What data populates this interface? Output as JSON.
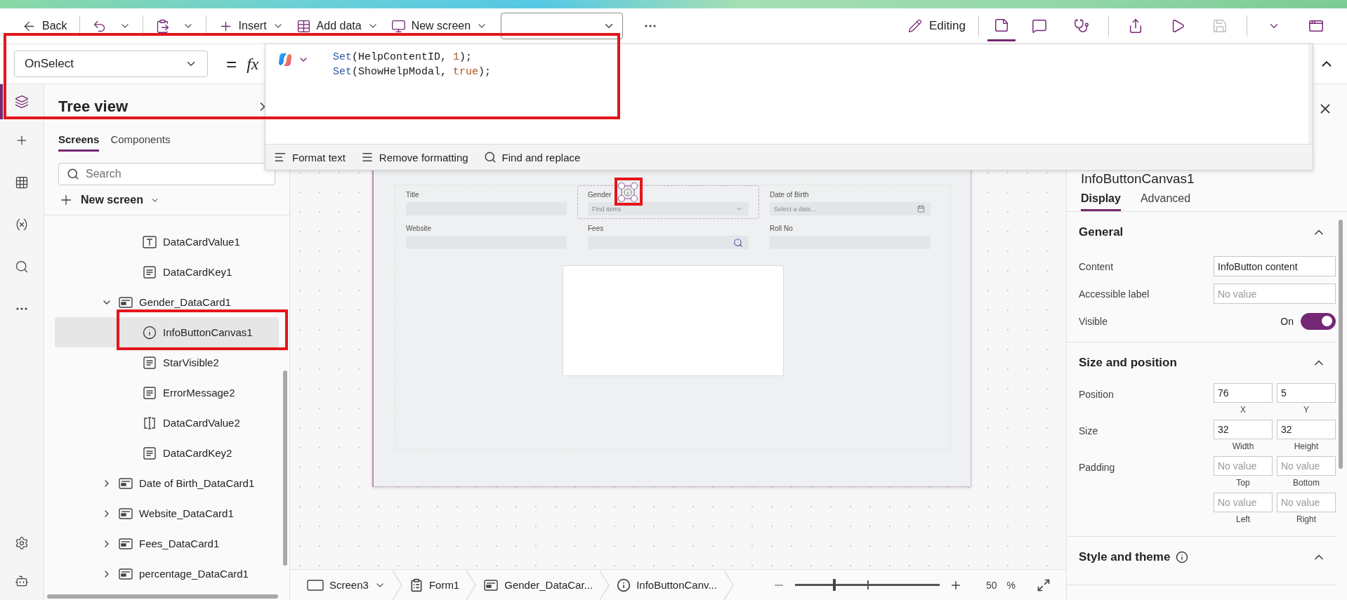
{
  "toolbar": {
    "left_groups": [
      [
        {
          "kind": "back",
          "label": "Back",
          "has_menu": false
        }
      ],
      [
        {
          "kind": "undo",
          "has_menu": true
        }
      ],
      [
        {
          "kind": "paste",
          "has_menu": true
        }
      ],
      [
        {
          "kind": "insert",
          "label": "Insert",
          "has_menu": true
        },
        {
          "kind": "add_data",
          "label": "Add data",
          "has_menu": true
        },
        {
          "kind": "new_screen",
          "label": "New screen",
          "has_menu": true
        }
      ]
    ],
    "mode": "Editing",
    "tool_groups": [
      [
        {
          "kind": "notes",
          "selected": true,
          "disabled": false
        },
        {
          "kind": "comments",
          "selected": false,
          "disabled": false
        },
        {
          "kind": "checker",
          "selected": false,
          "disabled": false
        }
      ],
      [
        {
          "kind": "share",
          "selected": false,
          "disabled": false
        },
        {
          "kind": "play",
          "selected": false,
          "disabled": false
        },
        {
          "kind": "save",
          "selected": false,
          "disabled": true
        }
      ],
      [
        {
          "kind": "caret",
          "selected": false,
          "disabled": false
        },
        {
          "kind": "publish",
          "selected": false,
          "disabled": false
        }
      ]
    ]
  },
  "formula": {
    "property": "OnSelect",
    "equals": "=",
    "fx": "fx",
    "lines": [
      [
        {
          "t": "Set",
          "kind": "function"
        },
        {
          "t": "(",
          "kind": "punct"
        },
        {
          "t": "HelpContentID",
          "kind": "identifier"
        },
        {
          "t": ", ",
          "kind": "punct"
        },
        {
          "t": "1",
          "kind": "number"
        },
        {
          "t": ");",
          "kind": "punct"
        }
      ],
      [
        {
          "t": "Set",
          "kind": "function"
        },
        {
          "t": "(",
          "kind": "punct"
        },
        {
          "t": "ShowHelpModal",
          "kind": "identifier"
        },
        {
          "t": ", ",
          "kind": "punct"
        },
        {
          "t": "true",
          "kind": "boolean"
        },
        {
          "t": ");",
          "kind": "punct"
        }
      ]
    ],
    "actions": [
      {
        "kind": "format",
        "label": "Format text"
      },
      {
        "kind": "remove_format",
        "label": "Remove formatting"
      },
      {
        "kind": "find",
        "label": "Find and replace"
      }
    ]
  },
  "rail": {
    "items": [
      {
        "kind": "tree_view",
        "selected": true
      },
      {
        "kind": "insert",
        "selected": false
      },
      {
        "kind": "data",
        "selected": false
      },
      {
        "kind": "variables",
        "selected": false
      },
      {
        "kind": "search",
        "selected": false
      },
      {
        "kind": "more",
        "selected": false
      }
    ],
    "bottom": [
      {
        "kind": "settings",
        "selected": false
      },
      {
        "kind": "agent",
        "selected": false
      }
    ]
  },
  "tree": {
    "title": "Tree view",
    "tabs": [
      {
        "label": "Screens",
        "selected": true
      },
      {
        "label": "Components",
        "selected": false
      }
    ],
    "search_placeholder": "Search",
    "new_screen": "New screen",
    "partial_children": [
      {
        "name": "DataCardValue1",
        "kind": "text",
        "selected": false
      },
      {
        "name": "DataCardKey1",
        "kind": "label",
        "selected": false
      }
    ],
    "items": [
      {
        "name": "Gender_DataCard1",
        "kind": "card",
        "expanded": true,
        "selected": false,
        "children": [
          {
            "name": "InfoButtonCanvas1",
            "kind": "info",
            "selected": true
          },
          {
            "name": "StarVisible2",
            "kind": "label",
            "selected": false
          },
          {
            "name": "ErrorMessage2",
            "kind": "label",
            "selected": false
          },
          {
            "name": "DataCardValue2",
            "kind": "input",
            "selected": false
          },
          {
            "name": "DataCardKey2",
            "kind": "label",
            "selected": false
          }
        ]
      },
      {
        "name": "Date of Birth_DataCard1",
        "kind": "card",
        "expanded": false,
        "selected": false
      },
      {
        "name": "Website_DataCard1",
        "kind": "card",
        "expanded": false,
        "selected": false
      },
      {
        "name": "Fees_DataCard1",
        "kind": "card",
        "expanded": false,
        "selected": false
      },
      {
        "name": "percentage_DataCard1",
        "kind": "card",
        "expanded": false,
        "selected": false
      }
    ]
  },
  "canvas": {
    "fields": [
      {
        "label": "Title",
        "kind": "text",
        "selected": false,
        "info_button": false
      },
      {
        "label": "Gender",
        "kind": "dropdown",
        "placeholder": "Find items",
        "selected": true,
        "info_button": true
      },
      {
        "label": "Date of Birth",
        "kind": "date",
        "placeholder": "Select a date...",
        "selected": false,
        "info_button": false
      },
      {
        "label": "Website",
        "kind": "text",
        "selected": false,
        "info_button": false
      },
      {
        "label": "Fees",
        "kind": "search",
        "selected": false,
        "info_button": false
      },
      {
        "label": "Roll No",
        "kind": "text",
        "selected": false,
        "info_button": false
      }
    ]
  },
  "status_bar": {
    "breadcrumbs": [
      {
        "kind": "screen",
        "label": "Screen3",
        "has_menu": true
      },
      {
        "kind": "form",
        "label": "Form1",
        "has_menu": false
      },
      {
        "kind": "card",
        "label": "Gender_DataCar...",
        "has_menu": false
      },
      {
        "kind": "info",
        "label": "InfoButtonCanv...",
        "has_menu": false
      }
    ],
    "zoom": {
      "level": 0.27,
      "value": "50",
      "unit": "%"
    }
  },
  "properties": {
    "title": "InfoButtonCanvas1",
    "tabs": [
      {
        "label": "Display",
        "selected": true
      },
      {
        "label": "Advanced",
        "selected": false
      }
    ],
    "sections": [
      {
        "title": "General",
        "expanded": true,
        "info": false,
        "rows": [
          {
            "kind": "text",
            "label": "Content",
            "value": "InfoButton content"
          },
          {
            "kind": "text",
            "label": "Accessible label",
            "placeholder": "No value"
          },
          {
            "kind": "toggle",
            "label": "Visible",
            "state_label": "On",
            "on": true
          }
        ]
      },
      {
        "title": "Size and position",
        "expanded": true,
        "info": false,
        "rows": [
          {
            "kind": "pair",
            "label": "Position",
            "fields": [
              {
                "value": "76",
                "caption": "X"
              },
              {
                "value": "5",
                "caption": "Y"
              }
            ]
          },
          {
            "kind": "pair",
            "label": "Size",
            "fields": [
              {
                "value": "32",
                "caption": "Width"
              },
              {
                "value": "32",
                "caption": "Height"
              }
            ]
          },
          {
            "kind": "pair",
            "label": "Padding",
            "fields": [
              {
                "placeholder": "No value",
                "caption": "Top"
              },
              {
                "placeholder": "No value",
                "caption": "Bottom"
              }
            ]
          },
          {
            "kind": "pair",
            "fields": [
              {
                "placeholder": "No value",
                "caption": "Left"
              },
              {
                "placeholder": "No value",
                "caption": "Right"
              }
            ]
          }
        ]
      },
      {
        "title": "Style and theme",
        "expanded": true,
        "info": true
      }
    ]
  }
}
